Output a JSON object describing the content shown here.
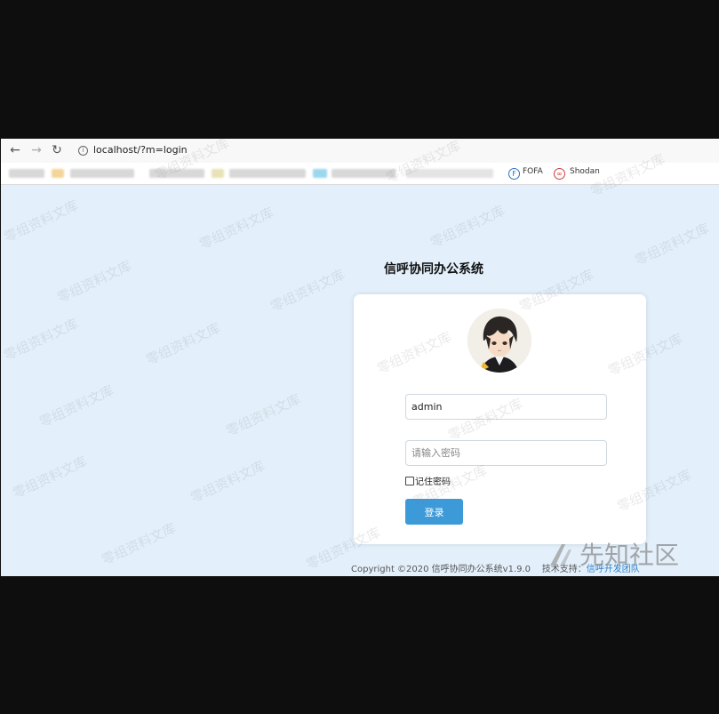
{
  "browser": {
    "url": "localhost/?m=login",
    "bookmarks": [
      {
        "label": "FOFA",
        "icon": "fofa-icon",
        "color": "#2f6fc8"
      },
      {
        "label": "Shodan",
        "icon": "shodan-icon",
        "color": "#d23a3a"
      }
    ]
  },
  "app": {
    "title": "信呼协同办公系统",
    "accent_color": "#3d9ad9"
  },
  "form": {
    "username_value": "admin",
    "password_placeholder": "请输入密码",
    "remember_label": "记住密码",
    "login_label": "登录"
  },
  "footer": {
    "copyright": "Copyright ©2020 信呼协同办公系统v1.9.0",
    "support_label": "技术支持：",
    "support_link": "信呼开发团队"
  },
  "watermark": {
    "text": "零组资料文库",
    "site_logo_text": "先知社区"
  }
}
